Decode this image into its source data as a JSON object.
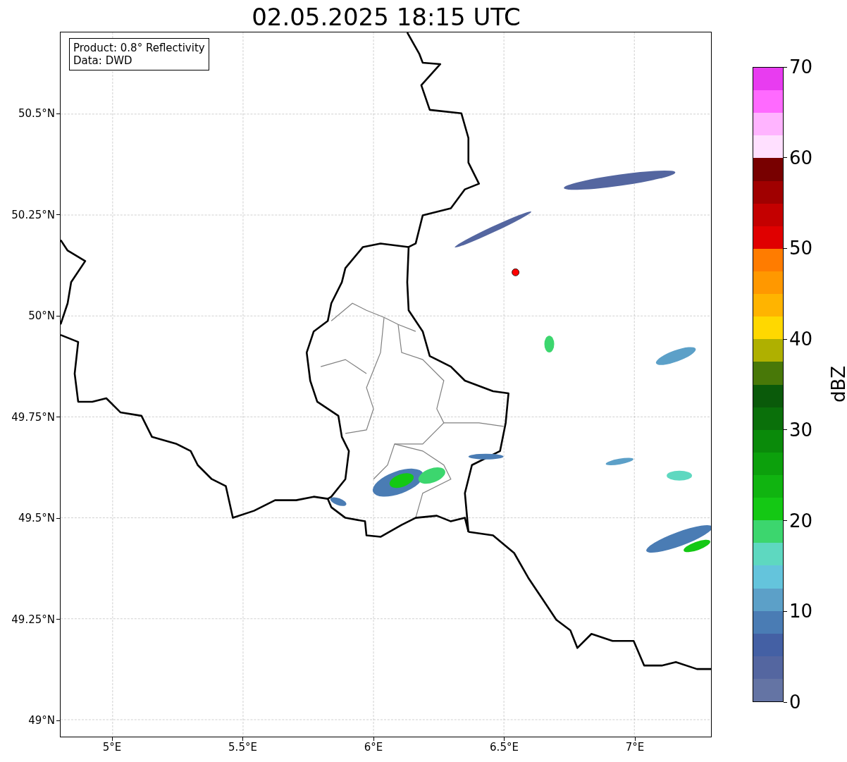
{
  "title": "02.05.2025 18:15 UTC",
  "info_box": {
    "lines": [
      "Product: 0.8° Reflectivity",
      "Data: DWD"
    ]
  },
  "map": {
    "lat_labels": [
      "50.5°N",
      "50.25°N",
      "50°N",
      "49.75°N",
      "49.5°N",
      "49.25°N",
      "49°N"
    ],
    "lon_labels": [
      "5°E",
      "5.5°E",
      "6°E",
      "6.5°E",
      "7°E"
    ]
  },
  "colorbar": {
    "label": "dBZ",
    "ticks": [
      "70",
      "60",
      "50",
      "40",
      "30",
      "20",
      "10",
      "0"
    ],
    "segments": [
      {
        "color": "#e83cf0"
      },
      {
        "color": "#ff6aff"
      },
      {
        "color": "#ffb4ff"
      },
      {
        "color": "#ffe0ff"
      },
      {
        "color": "#780000"
      },
      {
        "color": "#a00000"
      },
      {
        "color": "#c40000"
      },
      {
        "color": "#e00000"
      },
      {
        "color": "#ff7c00"
      },
      {
        "color": "#ff9800"
      },
      {
        "color": "#ffb400"
      },
      {
        "color": "#ffd800"
      },
      {
        "color": "#afb000"
      },
      {
        "color": "#487808"
      },
      {
        "color": "#0a5a0a"
      },
      {
        "color": "#0a700a"
      },
      {
        "color": "#0a8a0a"
      },
      {
        "color": "#0ca00c"
      },
      {
        "color": "#10b410"
      },
      {
        "color": "#14c814"
      },
      {
        "color": "#3cd66e"
      },
      {
        "color": "#5ed8c0"
      },
      {
        "color": "#64c4dc"
      },
      {
        "color": "#5ca0c8"
      },
      {
        "color": "#4a7cb4"
      },
      {
        "color": "#4460a4"
      },
      {
        "color": "#5466a0"
      },
      {
        "color": "#6474a4"
      }
    ]
  }
}
